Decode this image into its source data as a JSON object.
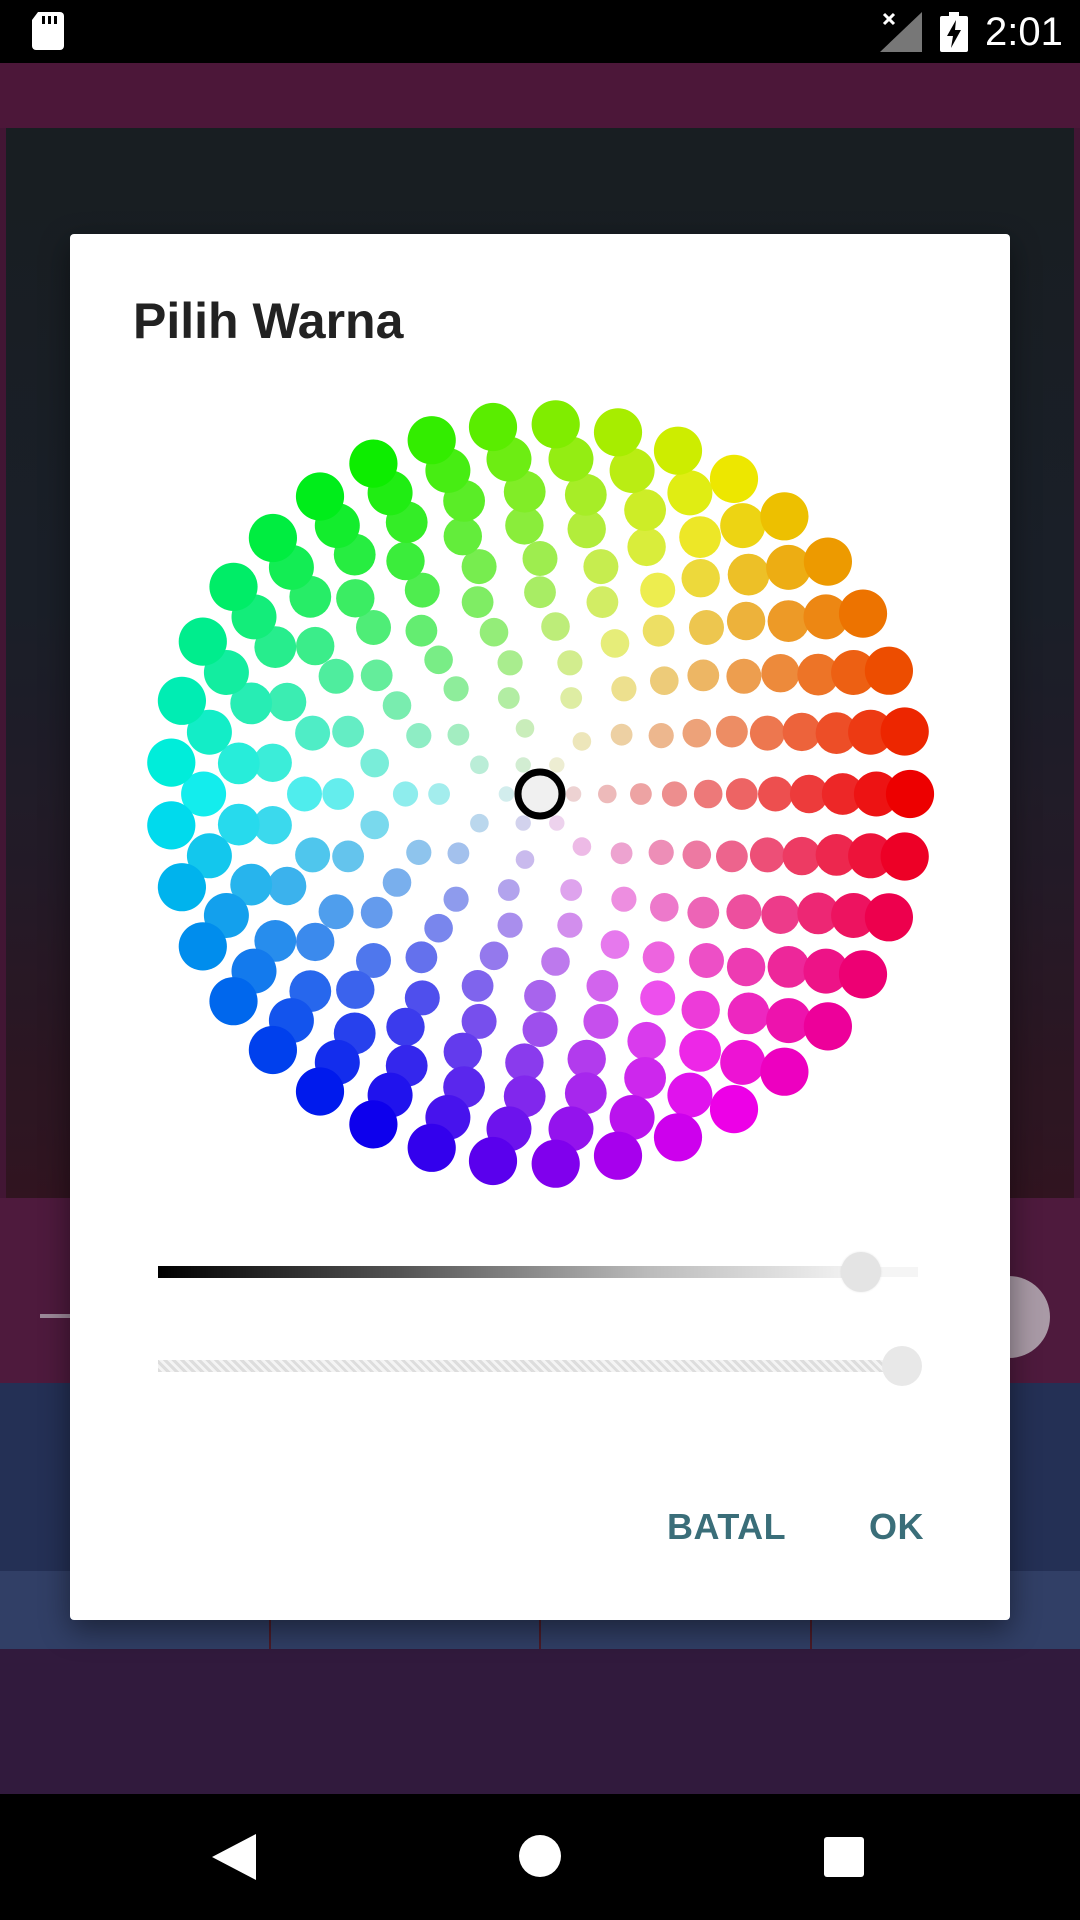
{
  "status_bar": {
    "time": "2:01",
    "icons": [
      "sd-card-icon",
      "signal-off-icon",
      "battery-charging-icon"
    ]
  },
  "background_app": {
    "tabs": [
      "",
      "",
      "",
      ""
    ]
  },
  "dialog": {
    "title": "Pilih Warna",
    "cancel_label": "BATAL",
    "ok_label": "OK",
    "selected_color": "#f0f0f0",
    "lightness_value": 0.93,
    "alpha_value": 1.0
  },
  "nav_bar": {
    "icons": [
      "back-icon",
      "home-icon",
      "recent-apps-icon"
    ]
  }
}
